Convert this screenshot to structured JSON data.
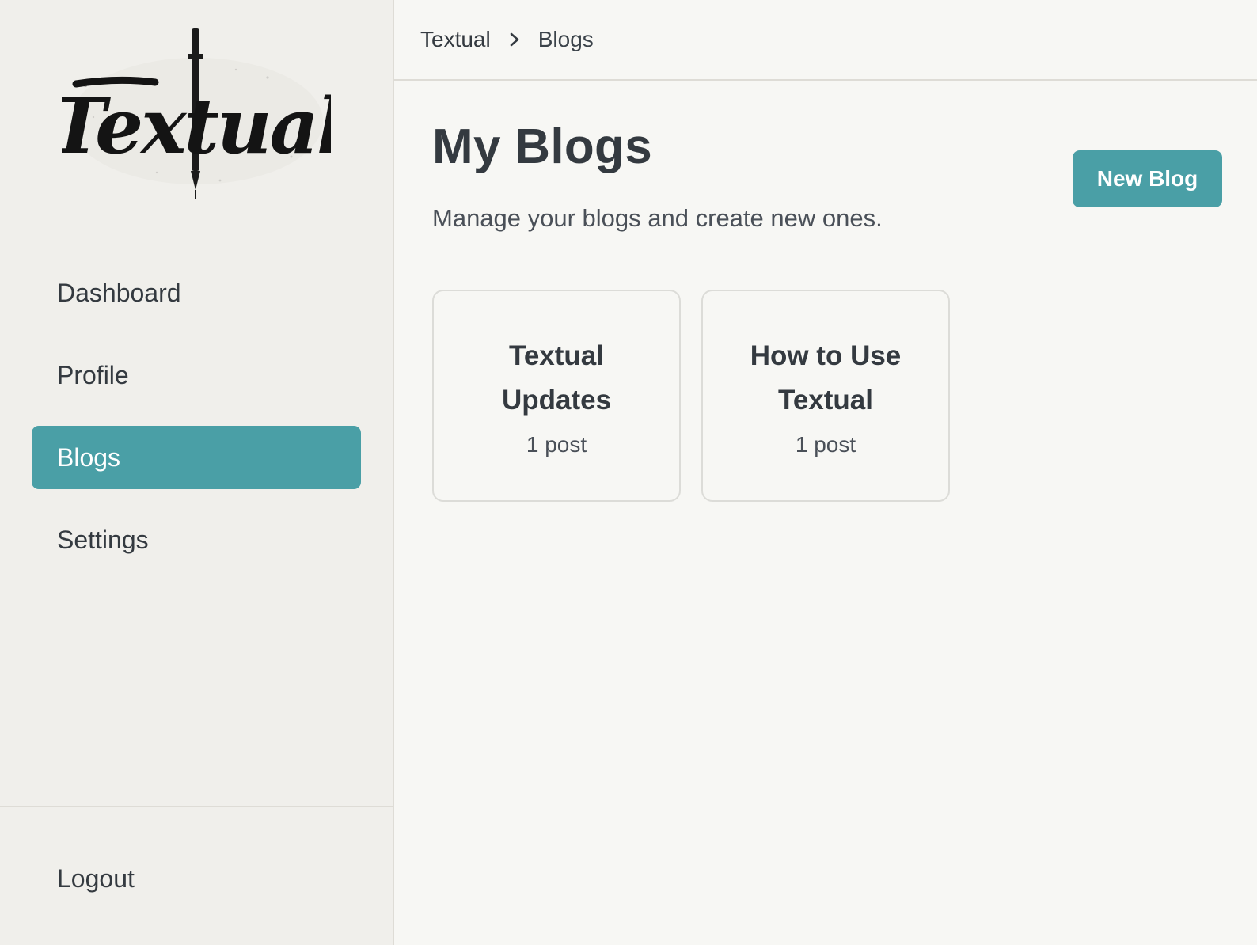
{
  "brand": {
    "logo_text": "Textual"
  },
  "breadcrumb": {
    "root": "Textual",
    "current": "Blogs"
  },
  "sidebar": {
    "items": [
      {
        "label": "Dashboard",
        "active": false
      },
      {
        "label": "Profile",
        "active": false
      },
      {
        "label": "Blogs",
        "active": true
      },
      {
        "label": "Settings",
        "active": false
      }
    ],
    "logout_label": "Logout"
  },
  "main": {
    "title": "My Blogs",
    "subtitle": "Manage your blogs and create new ones.",
    "new_blog_label": "New Blog",
    "blogs": [
      {
        "title": "Textual Updates",
        "meta": "1 post"
      },
      {
        "title": "How to Use Textual",
        "meta": "1 post"
      }
    ]
  },
  "colors": {
    "accent": "#4a9fa6",
    "sidebar_bg": "#f0efeb",
    "main_bg": "#f7f7f4"
  }
}
